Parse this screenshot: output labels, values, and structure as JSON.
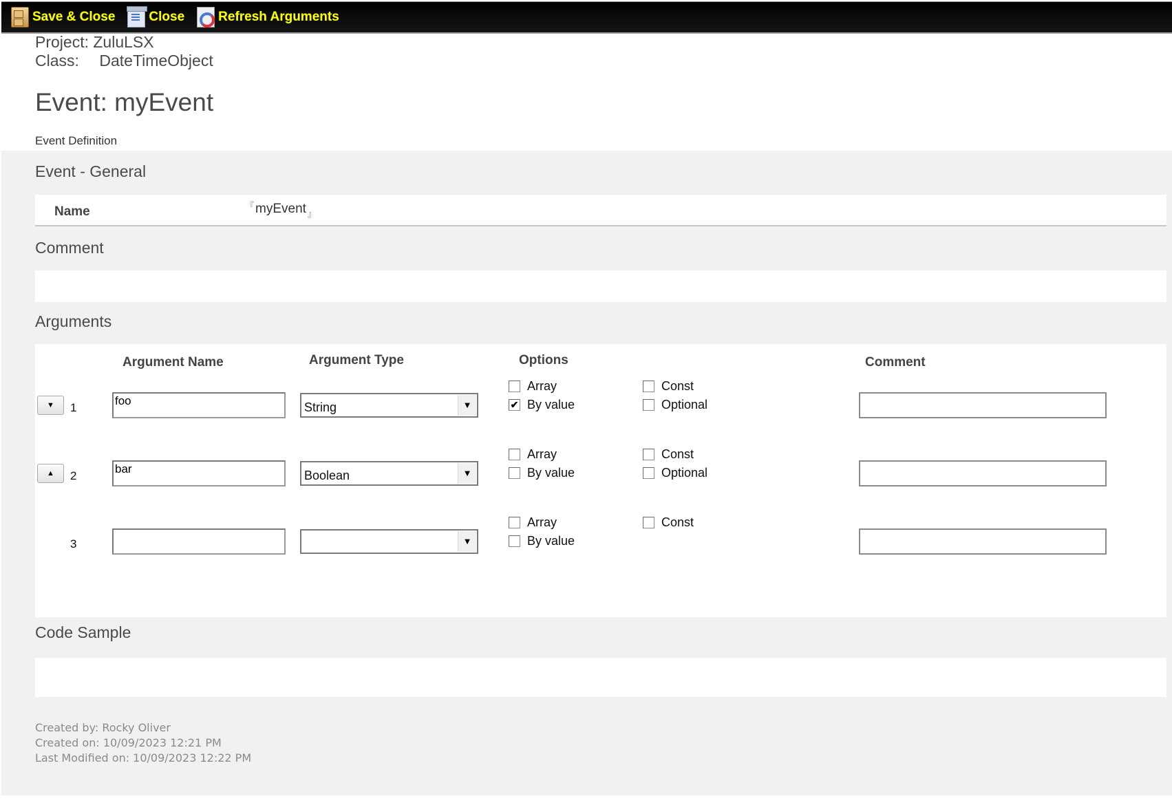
{
  "toolbar": {
    "buttons": [
      {
        "label": "Save & Close",
        "icon": "save-cabinet-icon"
      },
      {
        "label": "Close",
        "icon": "close-document-icon"
      },
      {
        "label": "Refresh Arguments",
        "icon": "refresh-icon"
      }
    ],
    "text_color": "#ffff00"
  },
  "header": {
    "project_label": "Project:",
    "project_value": "ZuluLSX",
    "class_label": "Class:",
    "class_value": "DateTimeObject",
    "title": "Event: myEvent",
    "subheading": "Event Definition"
  },
  "general": {
    "title": "Event - General",
    "name_label": "Name",
    "name_value": "myEvent",
    "corner_open": "『",
    "corner_close": "』"
  },
  "comment": {
    "title": "Comment",
    "value": ""
  },
  "arguments": {
    "title": "Arguments",
    "columns": {
      "name": "Argument Name",
      "type": "Argument Type",
      "options": "Options",
      "comment": "Comment"
    },
    "rows": [
      {
        "index": "1",
        "move_button": "▼",
        "name": "foo",
        "type": "String",
        "comment": "",
        "options": {
          "array": {
            "label": "Array",
            "checked": false
          },
          "by_value": {
            "label": "By value",
            "checked": true
          },
          "const": {
            "label": "Const",
            "checked": false
          },
          "optional": {
            "label": "Optional",
            "checked": false
          }
        }
      },
      {
        "index": "2",
        "move_button": "▲",
        "name": "bar",
        "type": "Boolean",
        "comment": "",
        "options": {
          "array": {
            "label": "Array",
            "checked": false
          },
          "by_value": {
            "label": "By value",
            "checked": false
          },
          "const": {
            "label": "Const",
            "checked": false
          },
          "optional": {
            "label": "Optional",
            "checked": false
          }
        }
      },
      {
        "index": "3",
        "name": "",
        "type": "",
        "comment": "",
        "options": {
          "array": {
            "label": "Array",
            "checked": false
          },
          "by_value": {
            "label": "By value",
            "checked": false
          },
          "const": {
            "label": "Const",
            "checked": false
          }
        }
      }
    ],
    "dropdown_arrow": "▼",
    "check_mark": "✔"
  },
  "code_sample": {
    "title": "Code Sample",
    "value": ""
  },
  "footer": {
    "created_by": "Created by: Rocky Oliver",
    "created_on": "Created on: 10/09/2023 12:21 PM",
    "last_modified": "Last Modified on: 10/09/2023 12:22 PM"
  }
}
